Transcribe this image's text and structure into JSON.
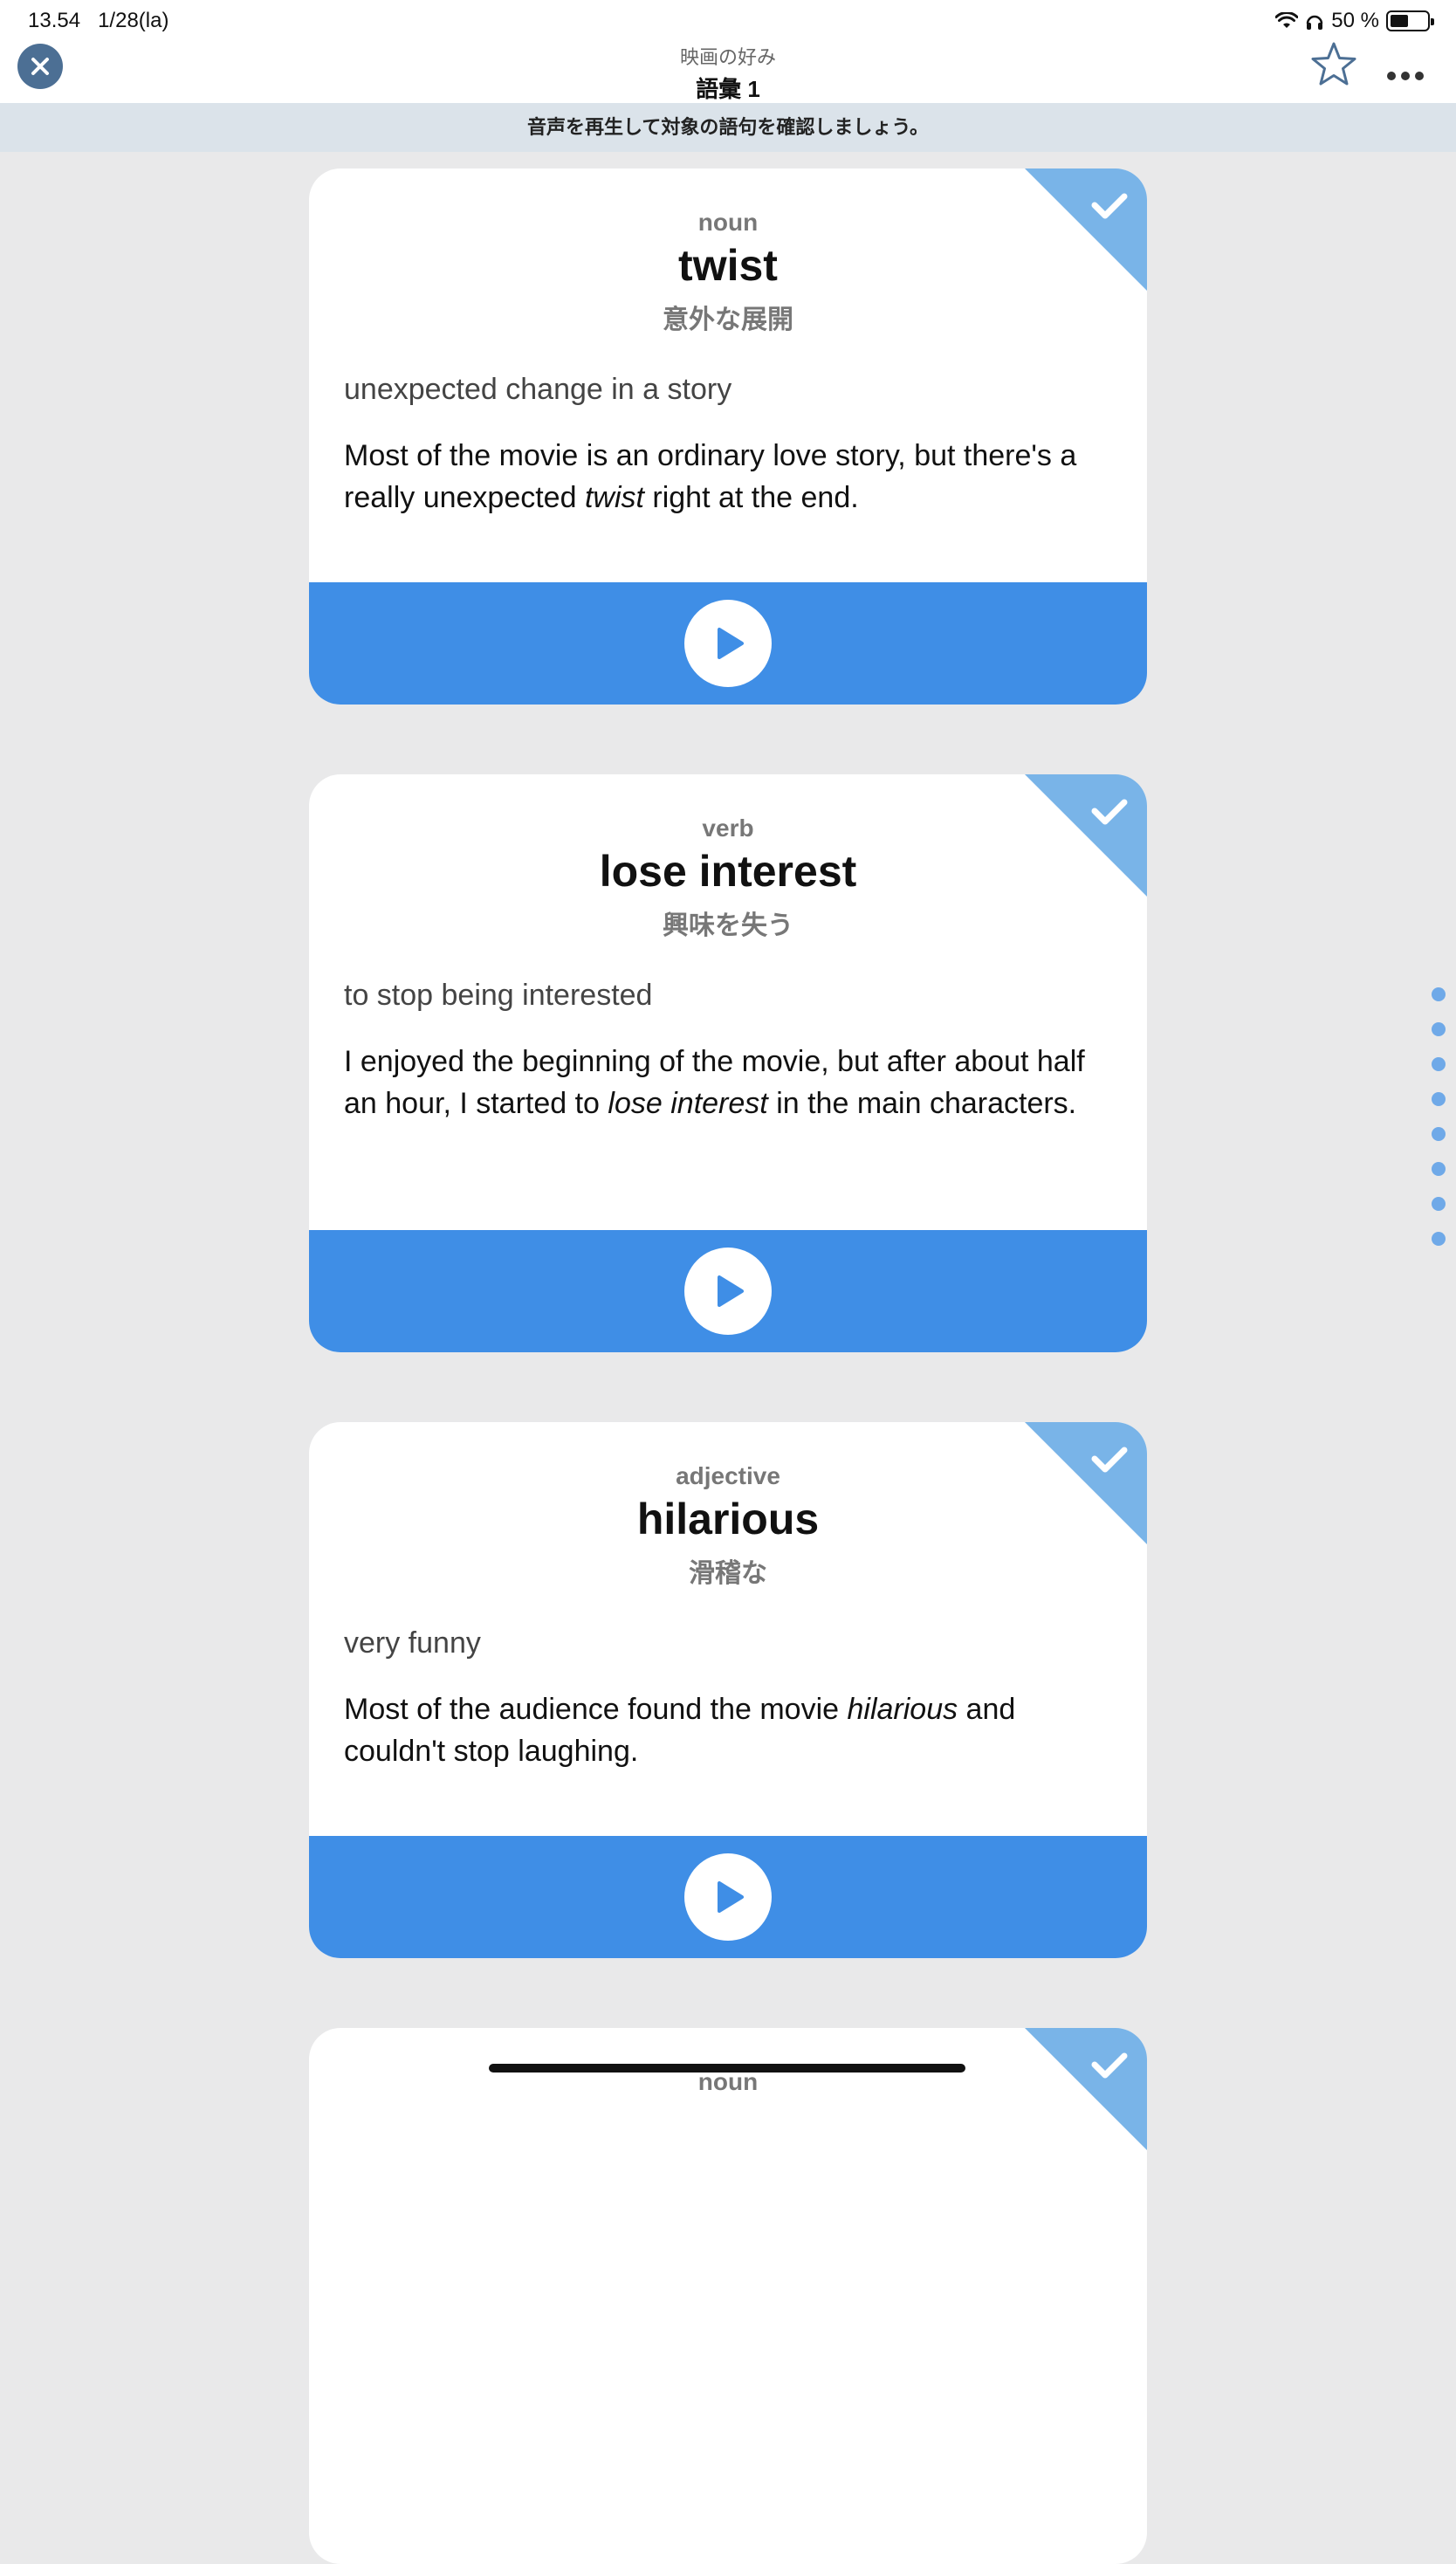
{
  "status_bar": {
    "time": "13.54",
    "date": "1/28(la)",
    "battery": "50 %"
  },
  "header": {
    "subtitle": "映画の好み",
    "title": "語彙 1"
  },
  "instruction": "音声を再生して対象の語句を確認しましょう。",
  "cards": [
    {
      "pos": "noun",
      "word": "twist",
      "translation": "意外な展開",
      "definition": "unexpected change in a story",
      "example_before": "Most of the movie is an ordinary love story, but there's a really unexpected ",
      "example_highlight": "twist",
      "example_after": " right at the end.",
      "checked": true
    },
    {
      "pos": "verb",
      "word": "lose interest",
      "translation": "興味を失う",
      "definition": "to stop being interested",
      "example_before": "I enjoyed the beginning of the movie, but after about half an hour, I started to ",
      "example_highlight": "lose interest",
      "example_after": " in the main characters.",
      "checked": true
    },
    {
      "pos": "adjective",
      "word": "hilarious",
      "translation": "滑稽な",
      "definition": "very funny",
      "example_before": "Most of the audience found the movie ",
      "example_highlight": "hilarious",
      "example_after": " and couldn't stop laughing.",
      "checked": true
    },
    {
      "pos": "noun",
      "checked": true
    }
  ],
  "pager": {
    "dot_count": 8
  },
  "colors": {
    "accent_blue": "#3f8ee6",
    "corner_blue": "#79b4e8",
    "close_button": "#4c6f94",
    "instruction_bg": "#dbe3ea",
    "page_bg": "#e9e9ea"
  },
  "icons": {
    "close": "close-icon",
    "star": "star-outline-icon",
    "more": "ellipsis-icon",
    "play": "play-icon",
    "check": "checkmark-icon",
    "wifi": "wifi-icon",
    "headphones": "headphones-icon",
    "battery": "battery-icon"
  }
}
